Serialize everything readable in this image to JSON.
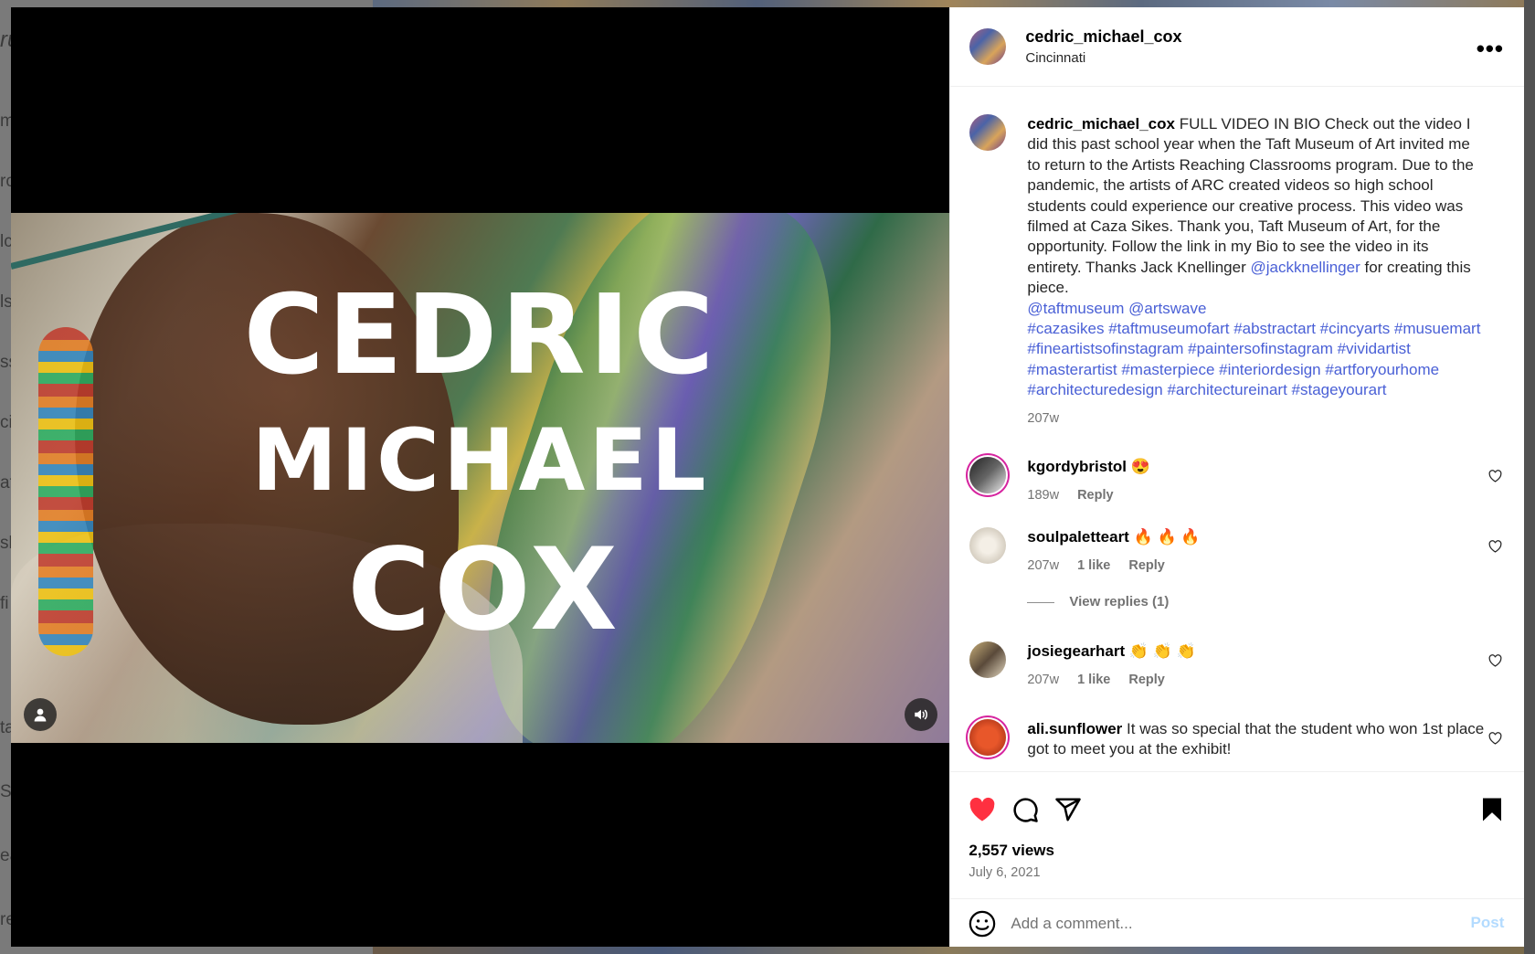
{
  "background": {
    "left_fragments": [
      "ru",
      "m",
      "ro",
      "lc",
      "ls",
      "ss",
      "cif",
      "at",
      "sh",
      "fi",
      "ta",
      "St",
      "ea",
      "re"
    ]
  },
  "video": {
    "title_lines": [
      "CEDRIC",
      "MICHAEL",
      "COX"
    ],
    "tag_icon": "person-icon",
    "audio_icon": "speaker-icon"
  },
  "post": {
    "username": "cedric_michael_cox",
    "location": "Cincinnati",
    "more_label": "•••",
    "caption": {
      "username": "cedric_michael_cox",
      "text": "FULL VIDEO IN BIO Check out the video I did this past school year when the Taft Museum of Art invited me to return to the Artists Reaching Classrooms program. Due to the pandemic, the artists of ARC created videos so high school students could experience our creative process. This video was filmed at Caza Sikes. Thank you, Taft Museum of Art, for the opportunity. Follow the link in my Bio to see the video in its entirety. Thanks Jack Knellinger",
      "mention": "@jackknellinger",
      "text_after": "for creating this piece.",
      "mentions_line": "@taftmuseum @artswave",
      "hashtags": "#cazasikes #taftmuseumofart #abstractart #cincyarts #musuemart #fineartistsofinstagram #paintersofinstagram #vividartist #masterartist #masterpiece #interiordesign #artforyourhome #architecturedesign #architectureinart #stageyourart",
      "time": "207w"
    },
    "comments": [
      {
        "username": "kgordybristol",
        "text": "😍",
        "time": "189w",
        "likes": "",
        "reply": "Reply"
      },
      {
        "username": "soulpaletteart",
        "text": "🔥 🔥 🔥",
        "time": "207w",
        "likes": "1 like",
        "reply": "Reply",
        "view_replies": "View replies (1)"
      },
      {
        "username": "josiegearhart",
        "text": "👏 👏 👏",
        "time": "207w",
        "likes": "1 like",
        "reply": "Reply"
      },
      {
        "username": "ali.sunflower",
        "text": "It was so special that the student who won 1st place got to meet you at the exhibit!"
      }
    ],
    "views": "2,557 views",
    "date": "July 6, 2021",
    "add_comment_placeholder": "Add a comment...",
    "post_label": "Post"
  },
  "colors": {
    "like_red": "#ff3040",
    "link_blue": "#4a60d6",
    "post_disabled": "#b3dbff"
  }
}
